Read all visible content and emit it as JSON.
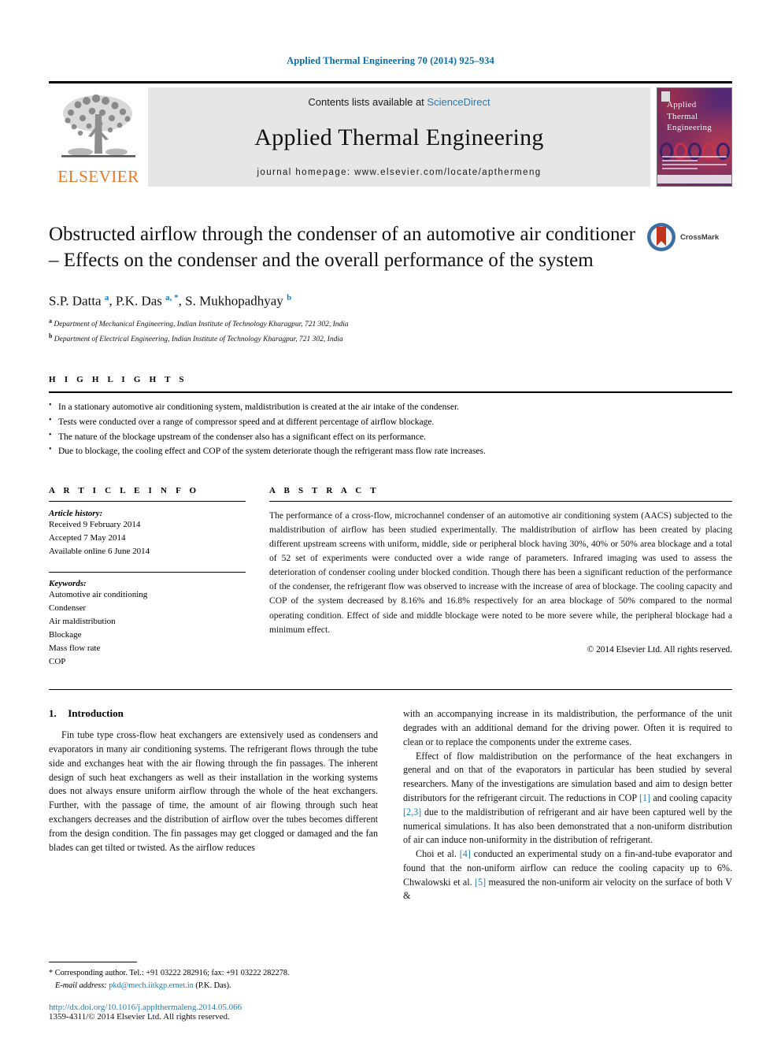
{
  "running_head": "Applied Thermal Engineering 70 (2014) 925–934",
  "masthead": {
    "contents_prefix": "Contents lists available at ",
    "sciencedirect": "ScienceDirect",
    "journal_title": "Applied Thermal Engineering",
    "homepage": "journal homepage: www.elsevier.com/locate/apthermeng",
    "publisher": "ELSEVIER",
    "cover_title_lines": [
      "Applied",
      "Thermal",
      "Engineering"
    ]
  },
  "article": {
    "title": "Obstructed airflow through the condenser of an automotive air conditioner – Effects on the condenser and the overall performance of the system",
    "crossmark_label": "CrossMark",
    "authors_html": "S.P. Datta <sup>a</sup>, P.K. Das <sup>a, *</sup>, S. Mukhopadhyay <sup>b</sup>",
    "affiliations": [
      "Department of Mechanical Engineering, Indian Institute of Technology Kharagpur, 721 302, India",
      "Department of Electrical Engineering, Indian Institute of Technology Kharagpur, 721 302, India"
    ]
  },
  "highlights": {
    "heading": "H I G H L I G H T S",
    "items": [
      "In a stationary automotive air conditioning system, maldistribution is created at the air intake of the condenser.",
      "Tests were conducted over a range of compressor speed and at different percentage of airflow blockage.",
      "The nature of the blockage upstream of the condenser also has a significant effect on its performance.",
      "Due to blockage, the cooling effect and COP of the system deteriorate though the refrigerant mass flow rate increases."
    ]
  },
  "article_info": {
    "heading": "A R T I C L E   I N F O",
    "history_label": "Article history:",
    "history": [
      "Received 9 February 2014",
      "Accepted 7 May 2014",
      "Available online 6 June 2014"
    ],
    "keywords_label": "Keywords:",
    "keywords": [
      "Automotive air conditioning",
      "Condenser",
      "Air maldistribution",
      "Blockage",
      "Mass flow rate",
      "COP"
    ]
  },
  "abstract": {
    "heading": "A B S T R A C T",
    "text": "The performance of a cross-flow, microchannel condenser of an automotive air conditioning system (AACS) subjected to the maldistribution of airflow has been studied experimentally. The maldistribution of airflow has been created by placing different upstream screens with uniform, middle, side or peripheral block having 30%, 40% or 50% area blockage and a total of 52 set of experiments were conducted over a wide range of parameters. Infrared imaging was used to assess the deterioration of condenser cooling under blocked condition. Though there has been a significant reduction of the performance of the condenser, the refrigerant flow was observed to increase with the increase of area of blockage. The cooling capacity and COP of the system decreased by 8.16% and 16.8% respectively for an area blockage of 50% compared to the normal operating condition. Effect of side and middle blockage were noted to be more severe while, the peripheral blockage had a minimum effect.",
    "copyright": "© 2014 Elsevier Ltd. All rights reserved."
  },
  "intro": {
    "section_number": "1.",
    "section_title": "Introduction",
    "left_paragraphs": [
      "Fin tube type cross-flow heat exchangers are extensively used as condensers and evaporators in many air conditioning systems. The refrigerant flows through the tube side and exchanges heat with the air flowing through the fin passages. The inherent design of such heat exchangers as well as their installation in the working systems does not always ensure uniform airflow through the whole of the heat exchangers. Further, with the passage of time, the amount of air flowing through such heat exchangers decreases and the distribution of airflow over the tubes becomes different from the design condition. The fin passages may get clogged or damaged and the fan blades can get tilted or twisted. As the airflow reduces"
    ],
    "right_paragraph_1": "with an accompanying increase in its maldistribution, the performance of the unit degrades with an additional demand for the driving power. Often it is required to clean or to replace the components under the extreme cases.",
    "right_paragraph_2_a": "Effect of flow maldistribution on the performance of the heat exchangers in general and on that of the evaporators in particular has been studied by several researchers. Many of the investigations are simulation based and aim to design better distributors for the refrigerant circuit. The reductions in COP ",
    "right_ref_1": "[1]",
    "right_paragraph_2_b": " and cooling capacity ",
    "right_ref_23": "[2,3]",
    "right_paragraph_2_c": " due to the maldistribution of refrigerant and air have been captured well by the numerical simulations. It has also been demonstrated that a non-uniform distribution of air can induce non-uniformity in the distribution of refrigerant.",
    "right_paragraph_3_a": "Choi et al. ",
    "right_ref_4": "[4]",
    "right_paragraph_3_b": " conducted an experimental study on a fin-and-tube evaporator and found that the non-uniform airflow can reduce the cooling capacity up to 6%. Chwalowski et al. ",
    "right_ref_5": "[5]",
    "right_paragraph_3_c": " measured the non-uniform air velocity on the surface of both V &"
  },
  "footnotes": {
    "corresponding": "* Corresponding author. Tel.: +91 03222 282916; fax: +91 03222 282278.",
    "email_label": "E-mail address:",
    "email": "pkd@mech.iitkgp.ernet.in",
    "email_suffix": "(P.K. Das).",
    "doi": "http://dx.doi.org/10.1016/j.applthermaleng.2014.05.066",
    "issn": "1359-4311/© 2014 Elsevier Ltd. All rights reserved."
  },
  "colors": {
    "link_blue": "#1a7fb5",
    "elsevier_orange": "#e87722",
    "masthead_gray": "#e6e6e6"
  }
}
